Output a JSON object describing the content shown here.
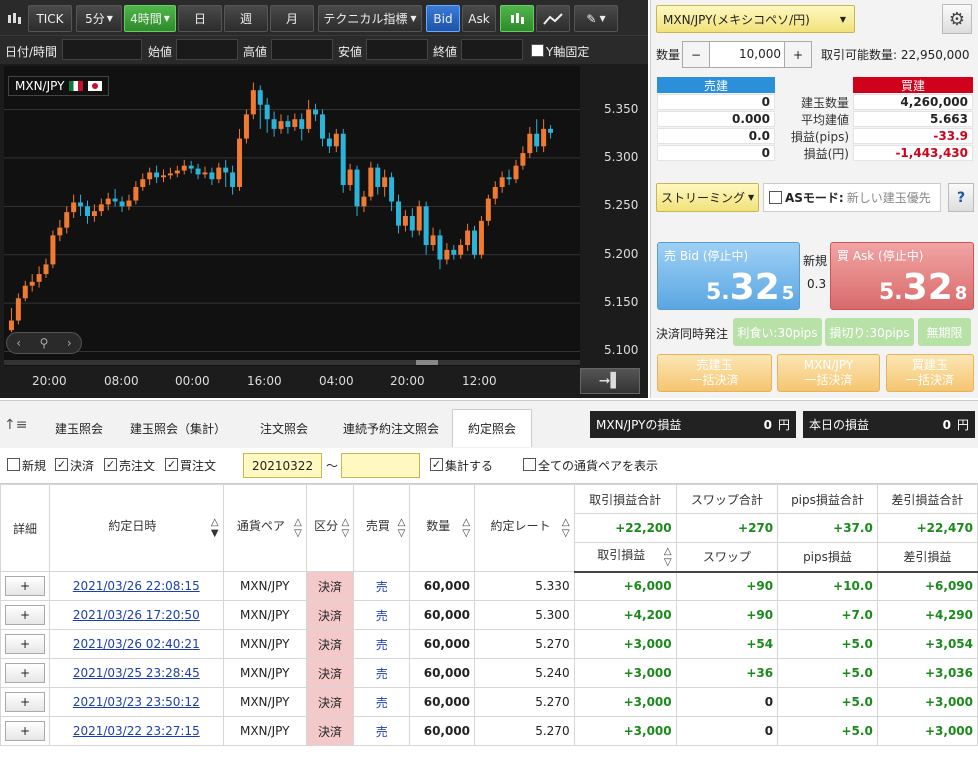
{
  "toolbar": {
    "tick": "TICK",
    "interval_5m": "5分",
    "interval_4h": "4時間",
    "day": "日",
    "week": "週",
    "month": "月",
    "technical": "テクニカル指標",
    "bid": "Bid",
    "ask": "Ask"
  },
  "date_row": {
    "datetime": "日付/時間",
    "open": "始値",
    "high": "高値",
    "low": "安値",
    "close": "終値",
    "y_fixed": "Y軸固定"
  },
  "chart_data": {
    "type": "candlestick",
    "symbol": "MXN/JPY",
    "yticks": [
      "5.350",
      "5.300",
      "5.250",
      "5.200",
      "5.150",
      "5.100"
    ],
    "ytick_values": [
      5.35,
      5.3,
      5.25,
      5.2,
      5.15,
      5.1
    ],
    "ylim": [
      5.085,
      5.395
    ],
    "xticks": [
      "20:00",
      "08:00",
      "00:00",
      "16:00",
      "04:00",
      "20:00",
      "12:00"
    ],
    "candles": [
      [
        5.122,
        5.132,
        5.145,
        5.12
      ],
      [
        5.132,
        5.155,
        5.16,
        5.128
      ],
      [
        5.155,
        5.168,
        5.173,
        5.152
      ],
      [
        5.168,
        5.172,
        5.18,
        5.162
      ],
      [
        5.172,
        5.18,
        5.188,
        5.166
      ],
      [
        5.18,
        5.19,
        5.196,
        5.176
      ],
      [
        5.19,
        5.22,
        5.225,
        5.186
      ],
      [
        5.22,
        5.228,
        5.236,
        5.214
      ],
      [
        5.228,
        5.244,
        5.25,
        5.222
      ],
      [
        5.244,
        5.254,
        5.262,
        5.238
      ],
      [
        5.254,
        5.25,
        5.262,
        5.24
      ],
      [
        5.25,
        5.24,
        5.256,
        5.232
      ],
      [
        5.24,
        5.245,
        5.252,
        5.234
      ],
      [
        5.245,
        5.252,
        5.258,
        5.24
      ],
      [
        5.252,
        5.258,
        5.264,
        5.246
      ],
      [
        5.258,
        5.255,
        5.268,
        5.25
      ],
      [
        5.255,
        5.25,
        5.26,
        5.244
      ],
      [
        5.25,
        5.256,
        5.262,
        5.246
      ],
      [
        5.256,
        5.27,
        5.276,
        5.252
      ],
      [
        5.27,
        5.278,
        5.284,
        5.266
      ],
      [
        5.278,
        5.285,
        5.29,
        5.272
      ],
      [
        5.285,
        5.28,
        5.292,
        5.274
      ],
      [
        5.28,
        5.282,
        5.288,
        5.275
      ],
      [
        5.282,
        5.284,
        5.29,
        5.278
      ],
      [
        5.284,
        5.287,
        5.292,
        5.28
      ],
      [
        5.287,
        5.292,
        5.298,
        5.283
      ],
      [
        5.292,
        5.289,
        5.297,
        5.284
      ],
      [
        5.289,
        5.283,
        5.294,
        5.278
      ],
      [
        5.283,
        5.285,
        5.291,
        5.279
      ],
      [
        5.285,
        5.278,
        5.29,
        5.272
      ],
      [
        5.278,
        5.29,
        5.295,
        5.274
      ],
      [
        5.29,
        5.285,
        5.298,
        5.27
      ],
      [
        5.285,
        5.27,
        5.292,
        5.262
      ],
      [
        5.27,
        5.32,
        5.33,
        5.266
      ],
      [
        5.32,
        5.345,
        5.35,
        5.315
      ],
      [
        5.345,
        5.37,
        5.378,
        5.34
      ],
      [
        5.37,
        5.355,
        5.375,
        5.33
      ],
      [
        5.355,
        5.34,
        5.362,
        5.326
      ],
      [
        5.34,
        5.33,
        5.348,
        5.322
      ],
      [
        5.33,
        5.338,
        5.345,
        5.325
      ],
      [
        5.338,
        5.332,
        5.344,
        5.325
      ],
      [
        5.332,
        5.34,
        5.346,
        5.328
      ],
      [
        5.34,
        5.33,
        5.346,
        5.318
      ],
      [
        5.33,
        5.35,
        5.36,
        5.326
      ],
      [
        5.35,
        5.345,
        5.356,
        5.338
      ],
      [
        5.345,
        5.32,
        5.35,
        5.312
      ],
      [
        5.32,
        5.312,
        5.326,
        5.305
      ],
      [
        5.312,
        5.325,
        5.33,
        5.306
      ],
      [
        5.325,
        5.272,
        5.33,
        5.264
      ],
      [
        5.272,
        5.288,
        5.294,
        5.266
      ],
      [
        5.288,
        5.25,
        5.292,
        5.24
      ],
      [
        5.25,
        5.26,
        5.266,
        5.244
      ],
      [
        5.26,
        5.29,
        5.296,
        5.256
      ],
      [
        5.29,
        5.27,
        5.294,
        5.262
      ],
      [
        5.27,
        5.28,
        5.288,
        5.26
      ],
      [
        5.28,
        5.255,
        5.285,
        5.245
      ],
      [
        5.255,
        5.23,
        5.262,
        5.222
      ],
      [
        5.23,
        5.24,
        5.246,
        5.224
      ],
      [
        5.24,
        5.225,
        5.248,
        5.218
      ],
      [
        5.225,
        5.25,
        5.256,
        5.22
      ],
      [
        5.25,
        5.21,
        5.255,
        5.2
      ],
      [
        5.21,
        5.22,
        5.228,
        5.204
      ],
      [
        5.22,
        5.195,
        5.226,
        5.185
      ],
      [
        5.195,
        5.205,
        5.212,
        5.19
      ],
      [
        5.205,
        5.2,
        5.21,
        5.195
      ],
      [
        5.2,
        5.21,
        5.216,
        5.196
      ],
      [
        5.21,
        5.225,
        5.232,
        5.204
      ],
      [
        5.225,
        5.2,
        5.23,
        5.196
      ],
      [
        5.2,
        5.235,
        5.24,
        5.196
      ],
      [
        5.235,
        5.258,
        5.262,
        5.23
      ],
      [
        5.258,
        5.27,
        5.276,
        5.252
      ],
      [
        5.27,
        5.28,
        5.286,
        5.264
      ],
      [
        5.28,
        5.278,
        5.288,
        5.272
      ],
      [
        5.278,
        5.292,
        5.298,
        5.274
      ],
      [
        5.292,
        5.305,
        5.312,
        5.288
      ],
      [
        5.305,
        5.325,
        5.332,
        5.3
      ],
      [
        5.325,
        5.312,
        5.34,
        5.306
      ],
      [
        5.312,
        5.33,
        5.34,
        5.306
      ],
      [
        5.33,
        5.326,
        5.334,
        5.32
      ]
    ]
  },
  "right": {
    "pair_select": "MXN/JPY(メキシコペソ/円)",
    "qty_label": "数量",
    "qty_value": "10,000",
    "minus": "−",
    "plus": "+",
    "tradable": "取引可能数量: 22,950,000",
    "sell_pos": "売建",
    "buy_pos": "買建",
    "rows": [
      {
        "sell": "0",
        "label": "建玉数量",
        "buy": "4,260,000"
      },
      {
        "sell": "0.000",
        "label": "平均建値",
        "buy": "5.663"
      },
      {
        "sell": "0.0",
        "label": "損益(pips)",
        "buy": "-33.9"
      },
      {
        "sell": "0",
        "label": "損益(円)",
        "buy": "-1,443,430"
      }
    ],
    "streaming": "ストリーミング",
    "as_mode": "ASモード:",
    "as_mode_value": "新しい建玉優先",
    "help": "?",
    "bid_title": "売 Bid (停止中)",
    "bid_int": "5.",
    "bid_big": "32",
    "bid_last": "5",
    "ask_title": "買 Ask (停止中)",
    "ask_int": "5.",
    "ask_big": "32",
    "ask_last": "8",
    "new_label": "新規",
    "spread": "0.3",
    "settle_label": "決済同時発注",
    "take_profit": "利食い:30pips",
    "stop_loss": "損切り:30pips",
    "unlimited": "無期限",
    "sell_all_1": "売建玉",
    "sell_all_2": "一括決済",
    "pair_all_1": "MXN/JPY",
    "pair_all_2": "一括決済",
    "buy_all_1": "買建玉",
    "buy_all_2": "一括決済"
  },
  "tabs": [
    "建玉照会",
    "建玉照会（集計）",
    "注文照会",
    "連続予約注文照会",
    "約定照会"
  ],
  "pl": {
    "pair_label": "MXN/JPYの損益",
    "pair_value": "0",
    "today_label": "本日の損益",
    "today_value": "0",
    "unit": "円"
  },
  "filters": {
    "new": "新規",
    "settle": "決済",
    "sell_order": "売注文",
    "buy_order": "買注文",
    "date_from": "20210322",
    "tilde": "〜",
    "aggregate": "集計する",
    "all_pairs": "全ての通貨ペアを表示"
  },
  "table": {
    "headers": {
      "detail": "詳細",
      "datetime": "約定日時",
      "pair": "通貨ペア",
      "kind": "区分",
      "side": "売買",
      "qty": "数量",
      "rate": "約定レート",
      "pl_total": "取引損益合計",
      "swap_total": "スワップ合計",
      "pips_total": "pips損益合計",
      "net_total": "差引損益合計",
      "pl": "取引損益",
      "swap": "スワップ",
      "pips": "pips損益",
      "net": "差引損益"
    },
    "totals": {
      "pl": "+22,200",
      "swap": "+270",
      "pips": "+37.0",
      "net": "+22,470"
    },
    "rows": [
      {
        "btn": "+",
        "datetime": "2021/03/26 22:08:15",
        "pair": "MXN/JPY",
        "kind": "決済",
        "side": "売",
        "qty": "60,000",
        "rate": "5.330",
        "pl": "+6,000",
        "swap": "+90",
        "pips": "+10.0",
        "net": "+6,090"
      },
      {
        "btn": "+",
        "datetime": "2021/03/26 17:20:50",
        "pair": "MXN/JPY",
        "kind": "決済",
        "side": "売",
        "qty": "60,000",
        "rate": "5.300",
        "pl": "+4,200",
        "swap": "+90",
        "pips": "+7.0",
        "net": "+4,290"
      },
      {
        "btn": "+",
        "datetime": "2021/03/26 02:40:21",
        "pair": "MXN/JPY",
        "kind": "決済",
        "side": "売",
        "qty": "60,000",
        "rate": "5.270",
        "pl": "+3,000",
        "swap": "+54",
        "pips": "+5.0",
        "net": "+3,054"
      },
      {
        "btn": "+",
        "datetime": "2021/03/25 23:28:45",
        "pair": "MXN/JPY",
        "kind": "決済",
        "side": "売",
        "qty": "60,000",
        "rate": "5.240",
        "pl": "+3,000",
        "swap": "+36",
        "pips": "+5.0",
        "net": "+3,036"
      },
      {
        "btn": "+",
        "datetime": "2021/03/23 23:50:12",
        "pair": "MXN/JPY",
        "kind": "決済",
        "side": "売",
        "qty": "60,000",
        "rate": "5.270",
        "pl": "+3,000",
        "swap": "0",
        "pips": "+5.0",
        "net": "+3,000"
      },
      {
        "btn": "+",
        "datetime": "2021/03/22 23:27:15",
        "pair": "MXN/JPY",
        "kind": "決済",
        "side": "売",
        "qty": "60,000",
        "rate": "5.270",
        "pl": "+3,000",
        "swap": "0",
        "pips": "+5.0",
        "net": "+3,000"
      }
    ]
  },
  "colors": {
    "up": "#f07a32",
    "down": "#2bb3d9",
    "accent_green": "#1a8a1a",
    "loss_red": "#d0021b"
  }
}
